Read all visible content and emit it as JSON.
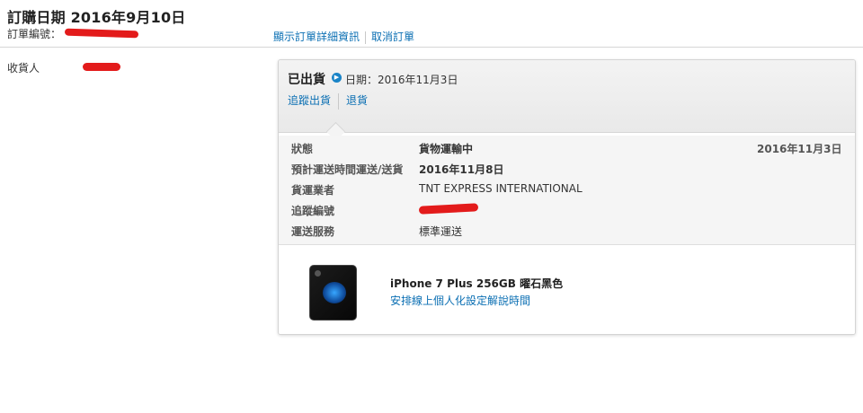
{
  "order": {
    "title": "訂購日期 2016年9月10日",
    "number_label": "訂單編號：",
    "links": {
      "details": "顯示訂單詳細資訊",
      "cancel": "取消訂單"
    },
    "recipient_label": "收貨人"
  },
  "shipment": {
    "status": "已出貨",
    "date": "日期：2016年11月3日",
    "links": {
      "track": "追蹤出貨",
      "return": "退貨"
    },
    "details": [
      {
        "label": "狀態",
        "value": "貨物運輸中",
        "extra": "2016年11月3日"
      },
      {
        "label": "預計運送時間運送/送貨",
        "value": "2016年11月8日"
      },
      {
        "label": "貨運業者",
        "value": "TNT EXPRESS INTERNATIONAL"
      },
      {
        "label": "追蹤編號"
      },
      {
        "label": "運送服務",
        "value": "標準運送"
      }
    ],
    "product": {
      "name": "iPhone 7 Plus 256GB 曜石黑色",
      "link": "安排線上個人化設定解說時間"
    }
  },
  "colors": {
    "link": "#0b6fb3",
    "redaction": "#e31b1b",
    "info_icon": "#1a84c7"
  },
  "icons": {
    "info": "info-arrow-icon"
  }
}
